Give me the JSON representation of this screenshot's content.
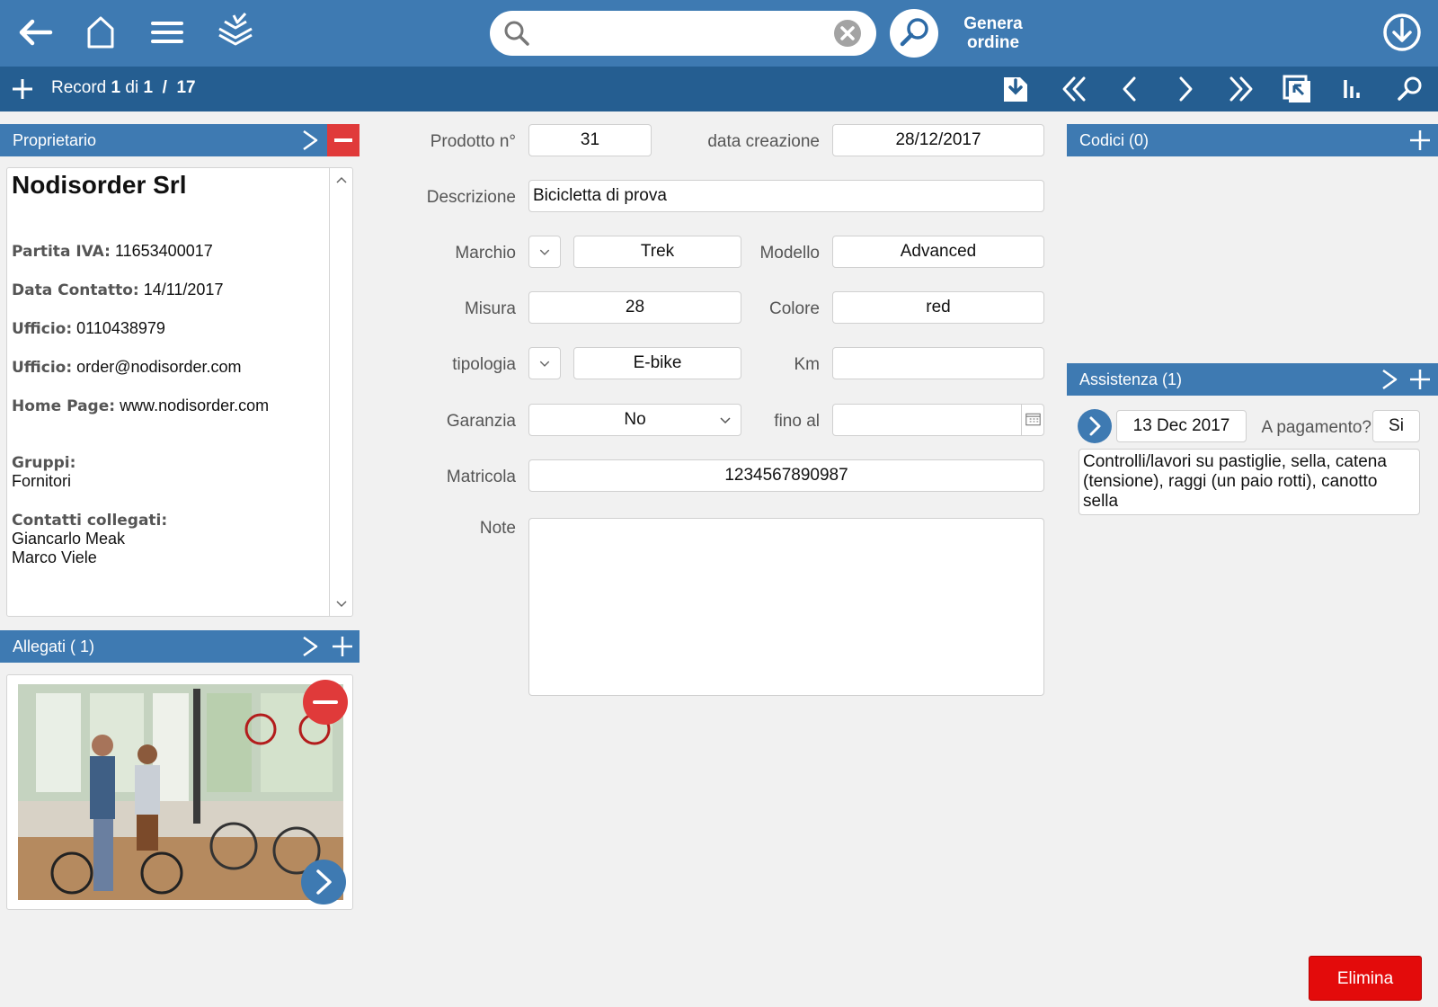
{
  "toolbar": {
    "search_placeholder": "",
    "search_value": "",
    "genera_line1": "Genera",
    "genera_line2": "ordine"
  },
  "navbar": {
    "record_label": "Record",
    "record_current": "1",
    "record_of": "di",
    "record_total": "1",
    "record_sep": "/",
    "record_all": "17"
  },
  "owner": {
    "header": "Proprietario",
    "name": "Nodisorder Srl",
    "fields": [
      {
        "key": "Partita IVA:",
        "value": "11653400017"
      },
      {
        "key": "Data Contatto:",
        "value": "14/11/2017"
      },
      {
        "key": "Ufficio:",
        "value": "0110438979"
      },
      {
        "key": "Ufficio:",
        "value": "order@nodisorder.com"
      },
      {
        "key": "Home Page:",
        "value": "www.nodisorder.com"
      }
    ],
    "groups_label": "Gruppi:",
    "groups_value": "Fornitori",
    "contacts_label": "Contatti collegati:",
    "contacts": [
      "Giancarlo Meak",
      "Marco Viele"
    ]
  },
  "attachments": {
    "header": "Allegati ( 1)"
  },
  "form": {
    "prodotto_label": "Prodotto n°",
    "prodotto_value": "31",
    "data_label": "data creazione",
    "data_value": "28/12/2017",
    "descrizione_label": "Descrizione",
    "descrizione_value": "Bicicletta di prova",
    "marchio_label": "Marchio",
    "marchio_value": "Trek",
    "modello_label": "Modello",
    "modello_value": "Advanced",
    "misura_label": "Misura",
    "misura_value": "28",
    "colore_label": "Colore",
    "colore_value": "red",
    "tipologia_label": "tipologia",
    "tipologia_value": "E-bike",
    "km_label": "Km",
    "km_value": "",
    "garanzia_label": "Garanzia",
    "garanzia_value": "No",
    "fino_label": "fino al",
    "fino_value": "",
    "matricola_label": "Matricola",
    "matricola_value": "1234567890987",
    "note_label": "Note",
    "note_value": ""
  },
  "codici": {
    "header": "Codici (0)"
  },
  "assistenza": {
    "header": "Assistenza (1)",
    "date": "13 Dec 2017",
    "pay_label": "A pagamento?",
    "pay_value": "Si",
    "description": "Controlli/lavori su pastiglie, sella, catena (tensione), raggi (un paio rotti), canotto sella"
  },
  "actions": {
    "elimina": "Elimina"
  },
  "colors": {
    "topbar": "#3e7ab2",
    "navbar": "#255e91",
    "danger": "#e03a3a",
    "background": "#f1f1f1"
  },
  "icons": [
    "back-arrow-icon",
    "home-icon",
    "menu-icon",
    "layers-icon",
    "search-icon",
    "clear-icon",
    "download-icon",
    "add-icon",
    "save-icon",
    "first-icon",
    "prev-icon",
    "next-icon",
    "last-icon",
    "select-icon",
    "stats-icon",
    "find-icon",
    "calendar-icon"
  ]
}
